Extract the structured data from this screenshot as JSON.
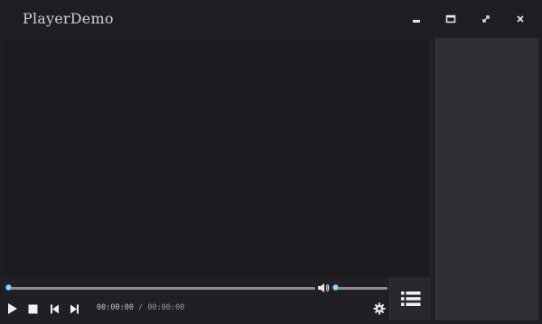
{
  "window": {
    "title": "PlayerDemo",
    "buttons": [
      "minimize-icon",
      "maximize-icon",
      "fullscreen-icon",
      "close-icon"
    ]
  },
  "player": {
    "current_time": "00:00:00",
    "separator": "/",
    "total_time": "00:00:00",
    "progress_fraction": 0.0,
    "volume_fraction": 0.0
  },
  "icons": {
    "play": "play-icon",
    "stop": "stop-icon",
    "prev": "skip-previous-icon",
    "next": "skip-next-icon",
    "volume": "volume-icon",
    "settings": "gear-icon",
    "playlist": "playlist-icon"
  },
  "colors": {
    "accent": "#4fa3d8",
    "background": "#1e1e23",
    "side_panel": "#2f2f36"
  }
}
